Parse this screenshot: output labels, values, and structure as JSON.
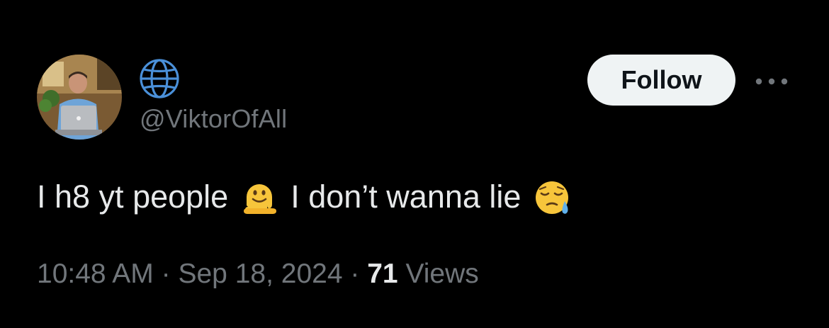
{
  "author": {
    "avatar_icon": "profile-photo-man-with-laptop",
    "display_name_icon": "globe-icon",
    "handle": "@ViktorOfAll"
  },
  "actions": {
    "follow_label": "Follow",
    "more_icon": "more-dots-icon"
  },
  "tweet": {
    "text_part1": "I h8 yt people",
    "emoji1": "melting-face-emoji",
    "text_part2": "I don’t wanna lie",
    "emoji2": "sleepy-face-emoji"
  },
  "meta": {
    "time": "10:48 AM",
    "separator1": "·",
    "date": "Sep 18, 2024",
    "separator2": "·",
    "views_count": "71",
    "views_label": "Views"
  },
  "colors": {
    "background": "#000000",
    "primary_text": "#e7e9ea",
    "secondary_text": "#71767b",
    "follow_bg": "#eff3f4",
    "follow_text": "#0f1419",
    "globe_blue": "#4a90d9"
  }
}
